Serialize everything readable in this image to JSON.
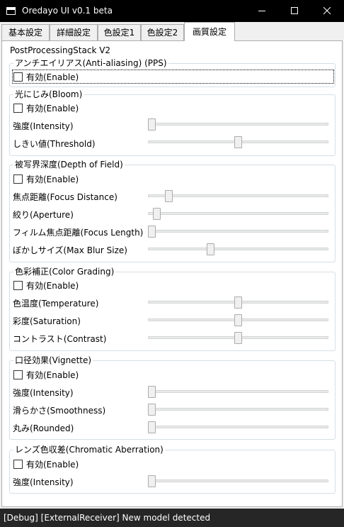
{
  "window": {
    "title": "Oredayo UI v0.1 beta"
  },
  "tabs": [
    {
      "label": "基本設定",
      "active": false
    },
    {
      "label": "詳細設定",
      "active": false
    },
    {
      "label": "色設定1",
      "active": false
    },
    {
      "label": "色設定2",
      "active": false
    },
    {
      "label": "画質設定",
      "active": true
    }
  ],
  "panel": {
    "title": "PostProcessingStack V2",
    "groups": [
      {
        "title": "アンチエイリアス(Anti-aliasing) (PPS)",
        "enable_label": "有効(Enable)",
        "enabled": false,
        "sliders": []
      },
      {
        "title": "光にじみ(Bloom)",
        "enable_label": "有効(Enable)",
        "enabled": false,
        "sliders": [
          {
            "label": "強度(Intensity)",
            "value": 0.0
          },
          {
            "label": "しきい値(Threshold)",
            "value": 0.5
          }
        ]
      },
      {
        "title": "被写界深度(Depth of Field)",
        "enable_label": "有効(Enable)",
        "enabled": false,
        "sliders": [
          {
            "label": "焦点距離(Focus Distance)",
            "value": 0.1
          },
          {
            "label": "絞り(Aperture)",
            "value": 0.03
          },
          {
            "label": "フィルム焦点距離(Focus Length)",
            "value": 0.0
          },
          {
            "label": "ぼかしサイズ(Max Blur Size)",
            "value": 0.34
          }
        ]
      },
      {
        "title": "色彩補正(Color Grading)",
        "enable_label": "有効(Enable)",
        "enabled": false,
        "sliders": [
          {
            "label": "色温度(Temperature)",
            "value": 0.5
          },
          {
            "label": "彩度(Saturation)",
            "value": 0.5
          },
          {
            "label": "コントラスト(Contrast)",
            "value": 0.5
          }
        ]
      },
      {
        "title": "口径効果(Vignette)",
        "enable_label": "有効(Enable)",
        "enabled": false,
        "sliders": [
          {
            "label": "強度(Intensity)",
            "value": 0.0
          },
          {
            "label": "滑らかさ(Smoothness)",
            "value": 0.0
          },
          {
            "label": "丸み(Rounded)",
            "value": 0.0
          }
        ]
      },
      {
        "title": "レンズ色収差(Chromatic Aberration)",
        "enable_label": "有効(Enable)",
        "enabled": false,
        "sliders": [
          {
            "label": "強度(Intensity)",
            "value": 0.0
          }
        ]
      }
    ]
  },
  "status": {
    "message": "[Debug] [ExternalReceiver] New model detected"
  }
}
